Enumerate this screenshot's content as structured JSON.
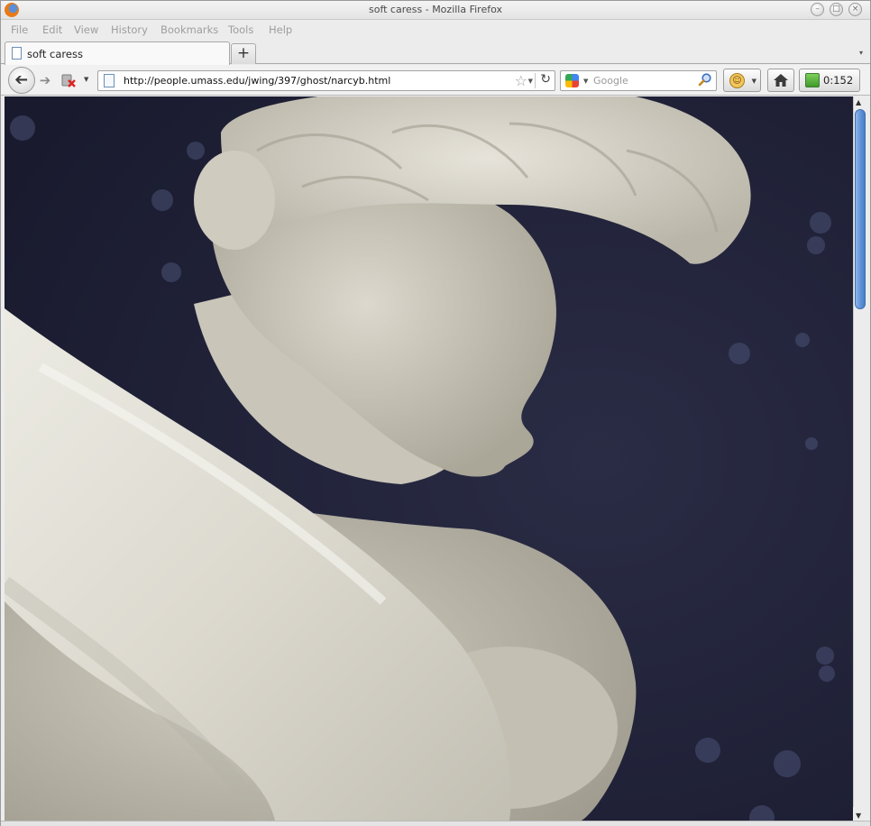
{
  "window": {
    "title": "soft caress - Mozilla Firefox",
    "controls": {
      "minimize": "–",
      "maximize": "□",
      "close": "×"
    }
  },
  "menubar": {
    "items": [
      "File",
      "Edit",
      "View",
      "History",
      "Bookmarks",
      "Tools",
      "Help"
    ]
  },
  "tabs": {
    "items": [
      {
        "label": "soft caress",
        "icon": "page-icon"
      }
    ],
    "new_tab_label": "+",
    "list_arrow": "▾"
  },
  "navbar": {
    "back": "➔",
    "forward": "➔",
    "url": "http://people.umass.edu/jwing/397/ghost/narcyb.html",
    "search_engine_icon": "google-icon",
    "search_placeholder": "Google",
    "timer": "0:152"
  },
  "content": {
    "image_alt": "soft caress",
    "image_description_icon": "marble-statue-photo",
    "background_color": "#20223a",
    "marble_color": "#d9d6cc"
  },
  "scrollbar": {
    "thumb_color": "#5b8fd6"
  }
}
